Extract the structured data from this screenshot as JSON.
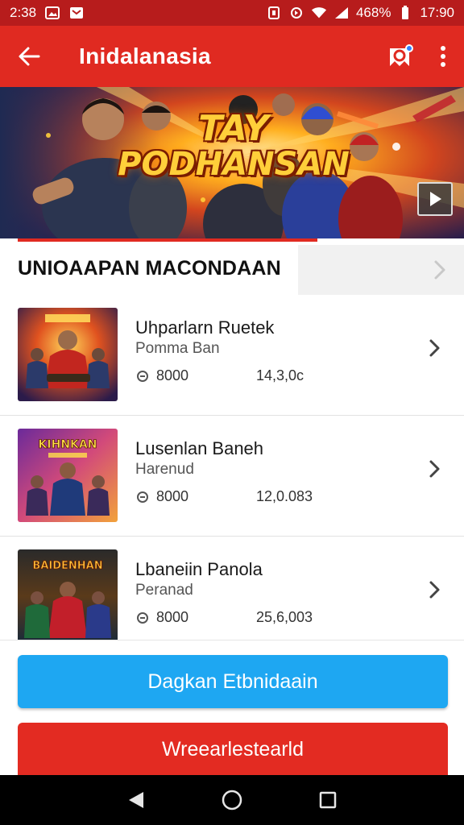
{
  "status_bar": {
    "time": "2:38",
    "battery": "468%",
    "clock_right": "17:90"
  },
  "app_bar": {
    "title": "Inidalanasia"
  },
  "banner": {
    "title_line1": "TAY",
    "title_line2": "PODHANSAN"
  },
  "section": {
    "title": "UNIOAAPAN MACONDAAN"
  },
  "items": [
    {
      "title": "Uhparlarn Ruetek",
      "subtitle": "Pomma Ban",
      "coins": "8000",
      "price": "14,3,0c",
      "thumb_label": ""
    },
    {
      "title": "Lusenlan Baneh",
      "subtitle": "Harenud",
      "coins": "8000",
      "price": "12,0.083",
      "thumb_label": "KIHNKAN"
    },
    {
      "title": "Lbaneiin Panola",
      "subtitle": "Peranad",
      "coins": "8000",
      "price": "25,6,003",
      "thumb_label": "BAIDENHAN"
    }
  ],
  "buttons": {
    "primary": "Dagkan Etbnidaain",
    "secondary": "Wreearlestearld"
  },
  "colors": {
    "app_bar": "#e02a21",
    "status_bar": "#b71c1c",
    "primary_button": "#1ea7f2",
    "secondary_button": "#e32b22"
  },
  "icons": [
    "back-arrow-icon",
    "notification-icon",
    "more-vert-icon",
    "play-icon",
    "chevron-right-icon",
    "coin-icon",
    "nav-back-icon",
    "nav-home-icon",
    "nav-recents-icon"
  ]
}
